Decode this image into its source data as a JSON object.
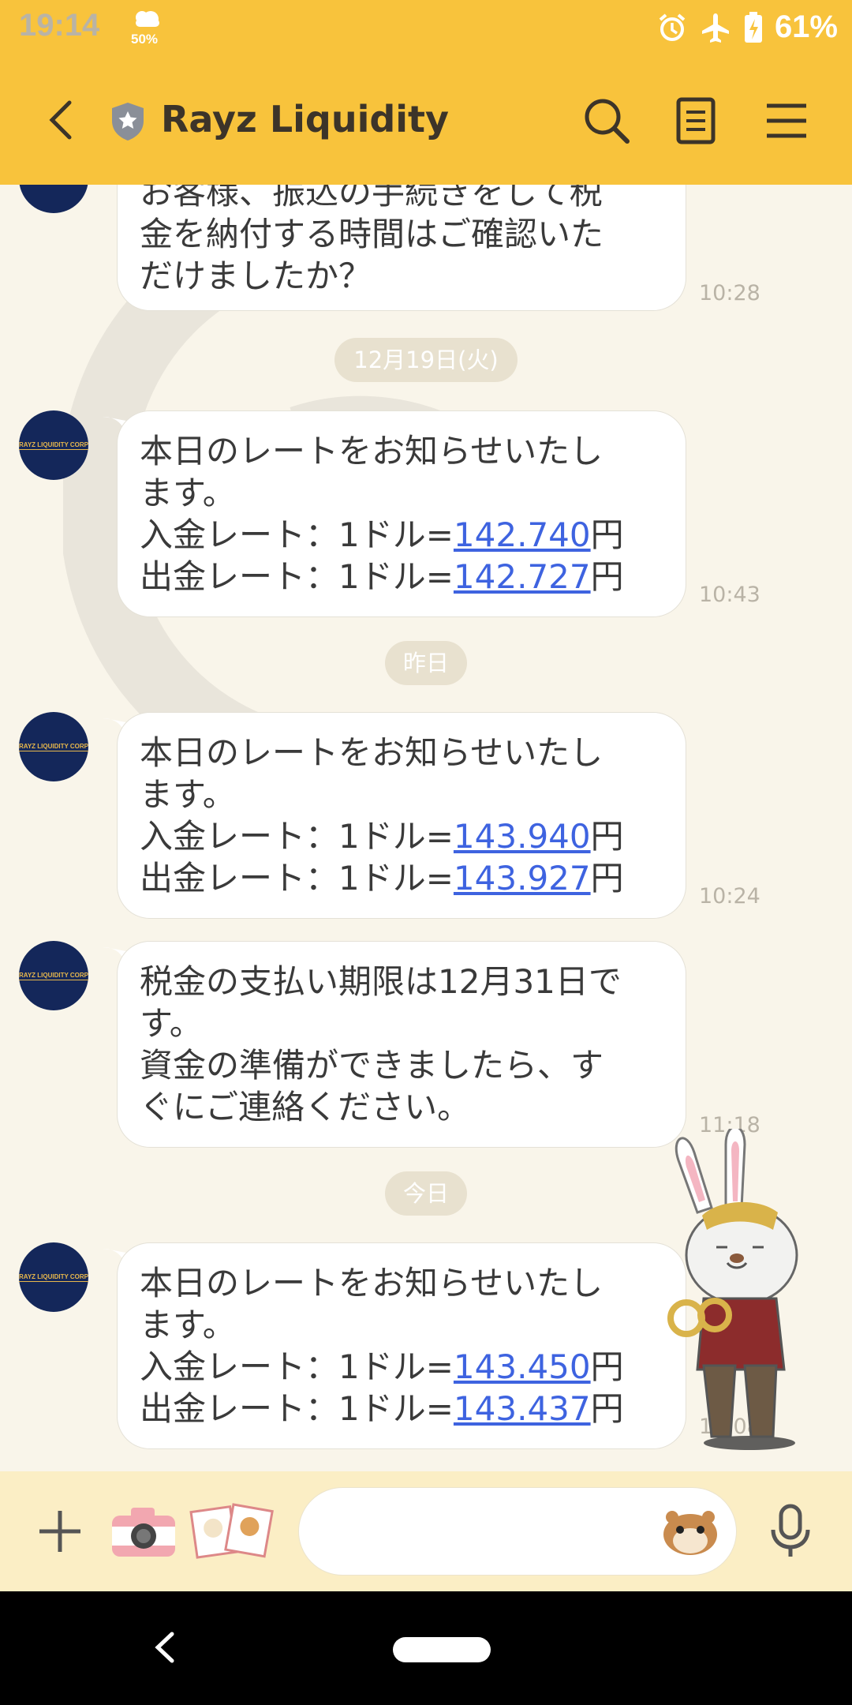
{
  "status_bar": {
    "time": "19:14",
    "weather_percent": "50%",
    "battery_percent": "61%",
    "icons": [
      "weather-icon",
      "alarm-icon",
      "airplane-mode-icon",
      "battery-charging-icon"
    ]
  },
  "header": {
    "title": "Rayz Liquidity",
    "icons": [
      "back-arrow-icon",
      "shield-star-icon",
      "search-icon",
      "notes-icon",
      "menu-icon"
    ],
    "color": "#f8c33c"
  },
  "avatar_logo_text": "RAYZ LIQUIDITY CORP",
  "messages": [
    {
      "lines": [
        "お客様、振込の手続きをして税",
        "金を納付する時間はご確認いた",
        "だけましたか？"
      ],
      "time": "10:28"
    },
    {
      "date": "12月19日(火)",
      "lines": [
        "本日のレートをお知らせいたし",
        "ます。"
      ],
      "rate_in": {
        "label": "入金レート：1ドル=",
        "value": "142.740",
        "unit": "円"
      },
      "rate_out": {
        "label": "出金レート：1ドル=",
        "value": "142.727",
        "unit": "円"
      },
      "time": "10:43"
    },
    {
      "date": "昨日",
      "lines": [
        "本日のレートをお知らせいたし",
        "ます。"
      ],
      "rate_in": {
        "label": "入金レート：1ドル=",
        "value": "143.940",
        "unit": "円"
      },
      "rate_out": {
        "label": "出金レート：1ドル=",
        "value": "143.927",
        "unit": "円"
      },
      "time": "10:24"
    },
    {
      "lines": [
        "税金の支払い期限は12月31日で",
        "す。",
        "資金の準備ができましたら、す",
        "ぐにご連絡ください。"
      ],
      "time": "11:18"
    },
    {
      "date": "今日",
      "lines": [
        "本日のレートをお知らせいたし",
        "ます。"
      ],
      "rate_in": {
        "label": "入金レート：1ドル=",
        "value": "143.450",
        "unit": "円"
      },
      "rate_out": {
        "label": "出金レート：1ドル=",
        "value": "143.437",
        "unit": "円"
      },
      "time": "10:08"
    }
  ],
  "input_bar": {
    "placeholder": "",
    "icons": [
      "plus-icon",
      "camera-icon",
      "sticker-icon",
      "emoji-icon",
      "microphone-icon"
    ],
    "color": "#fbeec5"
  },
  "nav_bar": {
    "icons": [
      "nav-back-icon",
      "home-pill-icon"
    ]
  },
  "colors": {
    "link": "#3e63e0",
    "background": "#f9f5ea",
    "avatar": "#14275a"
  }
}
